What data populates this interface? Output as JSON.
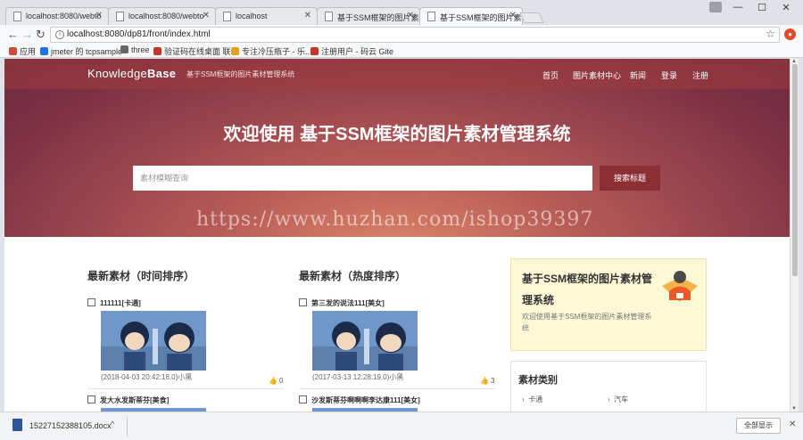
{
  "browser": {
    "tabs": [
      {
        "title": "localhost:8080/webto"
      },
      {
        "title": "localhost:8080/webto"
      },
      {
        "title": "localhost"
      },
      {
        "title": "基于SSM框架的图片素材"
      },
      {
        "title": "基于SSM框架的图片素材"
      }
    ],
    "url": "localhost:8080/dp81/front/index.html",
    "bookmarks": [
      {
        "label": "应用",
        "color": "#d04a3a"
      },
      {
        "label": "jmeter 的 tcpsample",
        "color": "#1a73e8"
      },
      {
        "label": "three",
        "color": "#666666"
      },
      {
        "label": "验证码在线桌面 联...",
        "color": "#c0392b"
      },
      {
        "label": "专注冷压瓶子 - 乐...",
        "color": "#e0a020"
      },
      {
        "label": "注册用户 - 码云 Gite",
        "color": "#c0392b"
      }
    ]
  },
  "site": {
    "brand_light": "Knowledge",
    "brand_bold": "Base",
    "brand_sub": "基于SSM框架的图片素材管理系统",
    "nav": [
      "首页",
      "图片素材中心",
      "新闻",
      "登录",
      "注册"
    ],
    "hero_title": "欢迎使用 基于SSM框架的图片素材管理系统",
    "search_placeholder": "素材模糊查询",
    "search_button": "搜索标题",
    "watermark": "https://www.huzhan.com/ishop39397"
  },
  "columns": [
    {
      "title": "最新素材（时间排序）",
      "items": [
        {
          "name": "111111[卡通]",
          "meta": "(2018-04-03 20:42:18.0)小黑",
          "likes": "0"
        },
        {
          "name": "发大水发斯蒂芬[美食]"
        }
      ]
    },
    {
      "title": "最新素材（热度排序）",
      "items": [
        {
          "name": "第三发的说法111[美女]",
          "meta": "(2017-03-13 12:28:19.0)小黑",
          "likes": "3"
        },
        {
          "name": "沙发斯蒂芬啊啊啊李达康111[美女]"
        }
      ]
    }
  ],
  "sidebar": {
    "card_title": "基于SSM框架的图片素材管理系统",
    "card_desc": "欢迎使用基于SSM框架的图片素材管理系统",
    "category_title": "素材类别",
    "categories": [
      "卡通",
      "汽车"
    ]
  },
  "downloads": {
    "filename": "15227152388105.docx",
    "show_all": "全部显示"
  },
  "icons": {
    "tab": "page-icon",
    "close": "close-icon",
    "back": "back-arrow-icon",
    "forward": "forward-arrow-icon",
    "reload": "reload-icon",
    "star": "star-icon",
    "edit": "edit-icon",
    "like": "thumbs-up-icon"
  },
  "colors": {
    "hero_dark": "#6a2a3e",
    "hero_light": "#e08a6a",
    "search_button": "#8c2f35",
    "side_card_bg": "#fdf8d6"
  }
}
